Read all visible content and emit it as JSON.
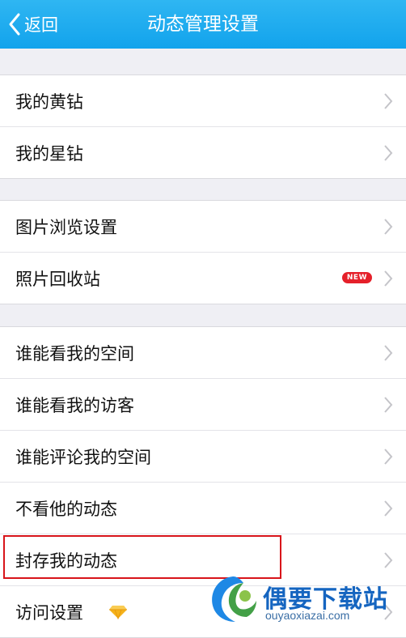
{
  "header": {
    "back_label": "返回",
    "title": "动态管理设置"
  },
  "sections": [
    {
      "items": [
        {
          "label": "我的黄钻"
        },
        {
          "label": "我的星钻"
        }
      ]
    },
    {
      "items": [
        {
          "label": "图片浏览设置"
        },
        {
          "label": "照片回收站",
          "badge": "NEW"
        }
      ]
    },
    {
      "items": [
        {
          "label": "谁能看我的空间"
        },
        {
          "label": "谁能看我的访客"
        },
        {
          "label": "谁能评论我的空间"
        },
        {
          "label": "不看他的动态"
        },
        {
          "label": "封存我的动态"
        },
        {
          "label": "访问设置"
        }
      ]
    }
  ],
  "watermark": {
    "title": "偶要下载站",
    "url": "ouyaoxiazai.com"
  },
  "colors": {
    "accent": "#12a3ec",
    "highlight": "#d8141a",
    "badge": "#e5202a",
    "gem": "#f5b21b"
  }
}
